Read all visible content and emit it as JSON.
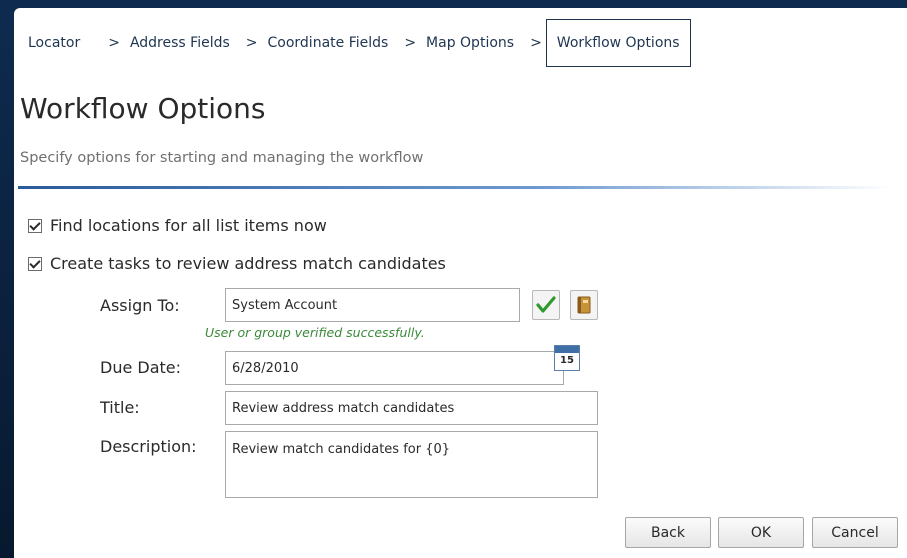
{
  "breadcrumb": {
    "items": [
      "Locator",
      "Address Fields",
      "Coordinate Fields",
      "Map Options"
    ],
    "separator": ">",
    "current": "Workflow Options"
  },
  "header": {
    "title": "Workflow Options",
    "subtitle": "Specify options for starting and managing the workflow"
  },
  "options": {
    "find_locations": {
      "label": "Find locations for all list items now",
      "checked": true
    },
    "create_tasks": {
      "label": "Create tasks to review address match candidates",
      "checked": true
    }
  },
  "form": {
    "assign_to": {
      "label": "Assign To:",
      "value": "System Account",
      "verify_message": "User or group verified successfully."
    },
    "due_date": {
      "label": "Due Date:",
      "value": "6/28/2010",
      "calendar_day": "15"
    },
    "title": {
      "label": "Title:",
      "value": "Review address match candidates"
    },
    "description": {
      "label": "Description:",
      "value": "Review match candidates for {0}"
    }
  },
  "buttons": {
    "back": "Back",
    "ok": "OK",
    "cancel": "Cancel"
  },
  "colors": {
    "accent": "#2a5a9a",
    "verify_green": "#3a8a3a",
    "background": "#0e2b4f"
  }
}
